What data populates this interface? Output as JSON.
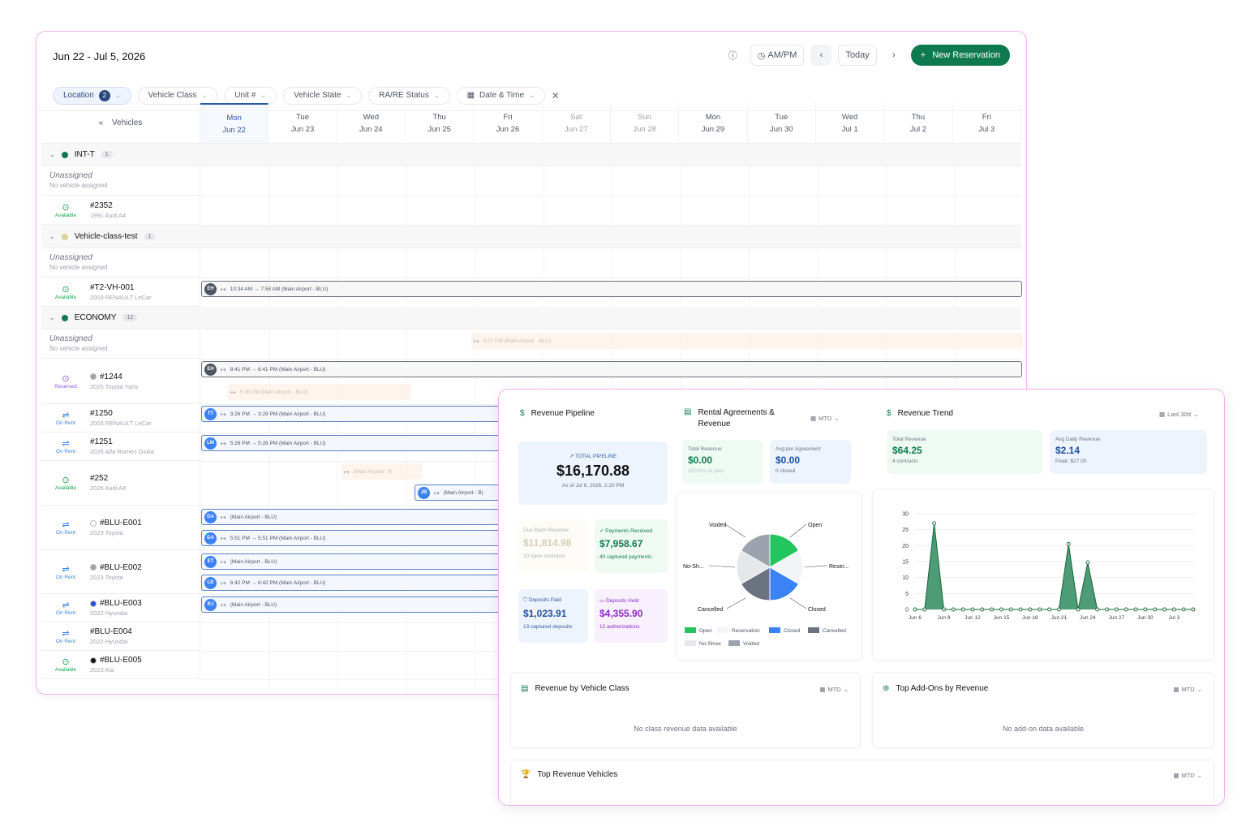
{
  "calendar": {
    "range": "Jun 22 - Jul 5, 2026",
    "ampm": "AM/PM",
    "today": "Today",
    "new_reservation": "New Reservation",
    "filters": [
      {
        "label": "Location",
        "count": "2",
        "active": true
      },
      {
        "label": "Vehicle Class"
      },
      {
        "label": "Unit #"
      },
      {
        "label": "Vehicle State"
      },
      {
        "label": "RA/RE Status"
      },
      {
        "label": "Date & Time"
      }
    ],
    "vehicles_label": "Vehicles",
    "days": [
      {
        "d": "Mon",
        "n": "Jun 22"
      },
      {
        "d": "Tue",
        "n": "Jun 23"
      },
      {
        "d": "Wed",
        "n": "Jun 24"
      },
      {
        "d": "Thu",
        "n": "Jun 25"
      },
      {
        "d": "Fri",
        "n": "Jun 26"
      },
      {
        "d": "Sat",
        "n": "Jun 27"
      },
      {
        "d": "Sun",
        "n": "Jun 28"
      },
      {
        "d": "Mon",
        "n": "Jun 29"
      },
      {
        "d": "Tue",
        "n": "Jun 30"
      },
      {
        "d": "Wed",
        "n": "Jul 1"
      },
      {
        "d": "Thu",
        "n": "Jul 2"
      },
      {
        "d": "Fri",
        "n": "Jul 3"
      }
    ],
    "groups": [
      {
        "name": "INT-T",
        "count": "1",
        "color": "#0f7a4f"
      },
      {
        "name": "Vehicle-class-test",
        "count": "1",
        "color": "#d8d49a"
      },
      {
        "name": "ECONOMY",
        "count": "12",
        "color": "#0f7a4f"
      }
    ],
    "unassigned": "Unassigned",
    "no_vehicle": "No vehicle assigned",
    "vehicles": [
      {
        "unit": "#2352",
        "model": "1991 Audi A4",
        "status": "Available"
      },
      {
        "unit": "#T2-VH-001",
        "model": "2003 RENAULT LeCar",
        "status": "Available"
      },
      {
        "unit": "#1244",
        "model": "2025 Toyota Yaris",
        "status": "Reserved"
      },
      {
        "unit": "#1250",
        "model": "2003 RENAULT LeCar",
        "status": "On Rent"
      },
      {
        "unit": "#1251",
        "model": "2026 Alfa Romeo Giulia",
        "status": "On Rent"
      },
      {
        "unit": "#252",
        "model": "2026 Audi A4",
        "status": "Available"
      },
      {
        "unit": "#BLU-E001",
        "model": "2023 Toyota",
        "status": "On Rent"
      },
      {
        "unit": "#BLU-E002",
        "model": "2023 Toyota",
        "status": "On Rent"
      },
      {
        "unit": "#BLU-E003",
        "model": "2022 Hyundai",
        "status": "On Rent"
      },
      {
        "unit": "#BLU-E004",
        "model": "2022 Hyundai",
        "status": "On Rent"
      },
      {
        "unit": "#BLU-E005",
        "model": "2023 Kia",
        "status": "Available"
      }
    ],
    "bookings": [
      {
        "initials": "EH",
        "text": "10:34 AM → 7:58 AM (Main Airport - BLU)"
      },
      {
        "text": "5:07 PM (Main Airport - BLU)"
      },
      {
        "initials": "EH",
        "text": "8:41 PM → 8:41 PM (Main Airport - BLU)"
      },
      {
        "text": "5:30 PM (Main Airport - BLU)"
      },
      {
        "initials": "TT",
        "text": "3:26 PM → 3:29 PM (Main Airport - BLU)"
      },
      {
        "initials": "LM",
        "text": "5:26 PM → 5:26 PM (Main Airport - BLU)"
      },
      {
        "text": "(Main Airport - B"
      },
      {
        "initials": "JB",
        "text": "(Main Airport - B)"
      },
      {
        "initials": "DA",
        "text": "(Main Airport - BLU)"
      },
      {
        "initials": "DA",
        "text": "5:51 PM → 5:51 PM (Main Airport - BLU)"
      },
      {
        "initials": "ET",
        "text": "(Main Airport - BLU)"
      },
      {
        "initials": "LD",
        "text": "6:42 PM → 6:42 PM (Main Airport - BLU)"
      },
      {
        "initials": "RJ",
        "text": "(Main Airport - BLU)"
      }
    ]
  },
  "dashboard": {
    "pipeline": {
      "title": "Revenue Pipeline",
      "label": "TOTAL PIPELINE",
      "value": "$16,170.88",
      "asof": "As of Jul 6, 2026, 2:20 PM",
      "due": {
        "l": "Due Back Revenue",
        "v": "$11,814.98",
        "s": "10 open contracts"
      },
      "received": {
        "l": "Payments Received",
        "v": "$7,958.67",
        "s": "40 captured payments"
      },
      "deposits": {
        "l": "Deposits Paid",
        "v": "$1,023.91",
        "s": "13 captured deposits"
      },
      "held": {
        "l": "Deposits Held",
        "v": "$4,355.90",
        "s": "12 authorizations"
      }
    },
    "agreements": {
      "title": "Rental Agreements & Revenue",
      "period": "MTD",
      "total": {
        "l": "Total Revenue",
        "v": "$0.00",
        "s": "100.0% vs prev"
      },
      "avg": {
        "l": "Avg per Agreement",
        "v": "$0.00",
        "s": "0 closed"
      },
      "pie_labels": [
        "Voided",
        "Open",
        "No-Sh...",
        "Reser...",
        "Cancelled",
        "Closed"
      ],
      "legend": [
        "Open",
        "Reservation",
        "Closed",
        "Cancelled",
        "No-Show",
        "Voided"
      ]
    },
    "trend": {
      "title": "Revenue Trend",
      "period": "Last 30d",
      "total": {
        "l": "Total Revenue",
        "v": "$64.25",
        "s": "4 contracts"
      },
      "avg": {
        "l": "Avg Daily Revenue",
        "v": "$2.14",
        "s": "Peak: $27.00"
      }
    },
    "by_class": {
      "title": "Revenue by Vehicle Class",
      "period": "MTD",
      "empty": "No class revenue data available"
    },
    "addons": {
      "title": "Top Add-Ons by Revenue",
      "period": "MTD",
      "empty": "No add-on data available"
    },
    "top_vehicles": {
      "title": "Top Revenue Vehicles",
      "period": "MTD"
    }
  },
  "chart_data": [
    {
      "type": "pie",
      "title": "",
      "categories": [
        "Open",
        "Reservation",
        "Closed",
        "Cancelled",
        "No-Show",
        "Voided"
      ],
      "values": [
        1,
        1,
        1,
        1,
        1,
        1
      ],
      "colors": [
        "#22c55e",
        "#f3f4f6",
        "#3b82f6",
        "#6b7280",
        "#e5e7eb",
        "#9ca3af"
      ]
    },
    {
      "type": "area",
      "title": "",
      "x": [
        "Jun 6",
        "Jun 7",
        "Jun 8",
        "Jun 9",
        "Jun 10",
        "Jun 11",
        "Jun 12",
        "Jun 13",
        "Jun 14",
        "Jun 15",
        "Jun 16",
        "Jun 17",
        "Jun 18",
        "Jun 19",
        "Jun 20",
        "Jun 21",
        "Jun 22",
        "Jun 23",
        "Jun 24",
        "Jun 25",
        "Jun 26",
        "Jun 27",
        "Jun 28",
        "Jun 29",
        "Jun 30",
        "Jul 1",
        "Jul 2",
        "Jul 3",
        "Jul 4",
        "Jul 5"
      ],
      "xticks": [
        "Jun 6",
        "Jun 9",
        "Jun 12",
        "Jun 15",
        "Jun 18",
        "Jun 21",
        "Jun 24",
        "Jun 27",
        "Jun 30",
        "Jul 3"
      ],
      "values": [
        0,
        0,
        27,
        0,
        0,
        0,
        0,
        0,
        0,
        0,
        0,
        0,
        0,
        0,
        0,
        0,
        20.5,
        0,
        14.75,
        0,
        0,
        0,
        0,
        0,
        0,
        0,
        0,
        0,
        0,
        0
      ],
      "ylim": [
        0,
        30
      ],
      "yticks": [
        0,
        5,
        10,
        15,
        20,
        25,
        30
      ],
      "grid": true,
      "color": "#2f8a5f"
    }
  ]
}
